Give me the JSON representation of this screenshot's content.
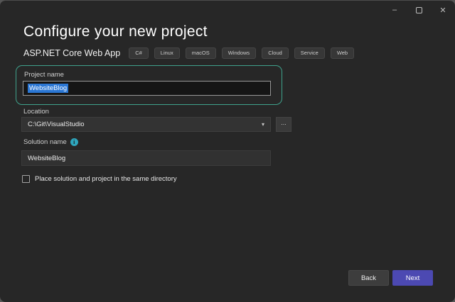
{
  "window": {
    "icons": {
      "minimize": "–",
      "close": "✕",
      "caret": "▾",
      "info": "i"
    }
  },
  "header": {
    "title": "Configure your new project"
  },
  "template": {
    "name": "ASP.NET Core Web App",
    "tags": [
      "C#",
      "Linux",
      "macOS",
      "Windows",
      "Cloud",
      "Service",
      "Web"
    ]
  },
  "form": {
    "project_name": {
      "label": "Project name",
      "value": "WebsiteBlog",
      "selected": true
    },
    "location": {
      "label": "Location",
      "value": "C:\\Git\\VisualStudio",
      "browse_label": "..."
    },
    "solution_name": {
      "label": "Solution name",
      "value": "WebsiteBlog"
    },
    "same_directory": {
      "label": "Place solution and project in the same directory",
      "checked": false
    }
  },
  "footer": {
    "back_label": "Back",
    "next_label": "Next"
  },
  "colors": {
    "window_background": "#272727",
    "focus_border": "#3fa28c",
    "text_selection": "#2b77d4",
    "next_button": "#4c49b2",
    "info_icon": "#2ea6bd"
  }
}
